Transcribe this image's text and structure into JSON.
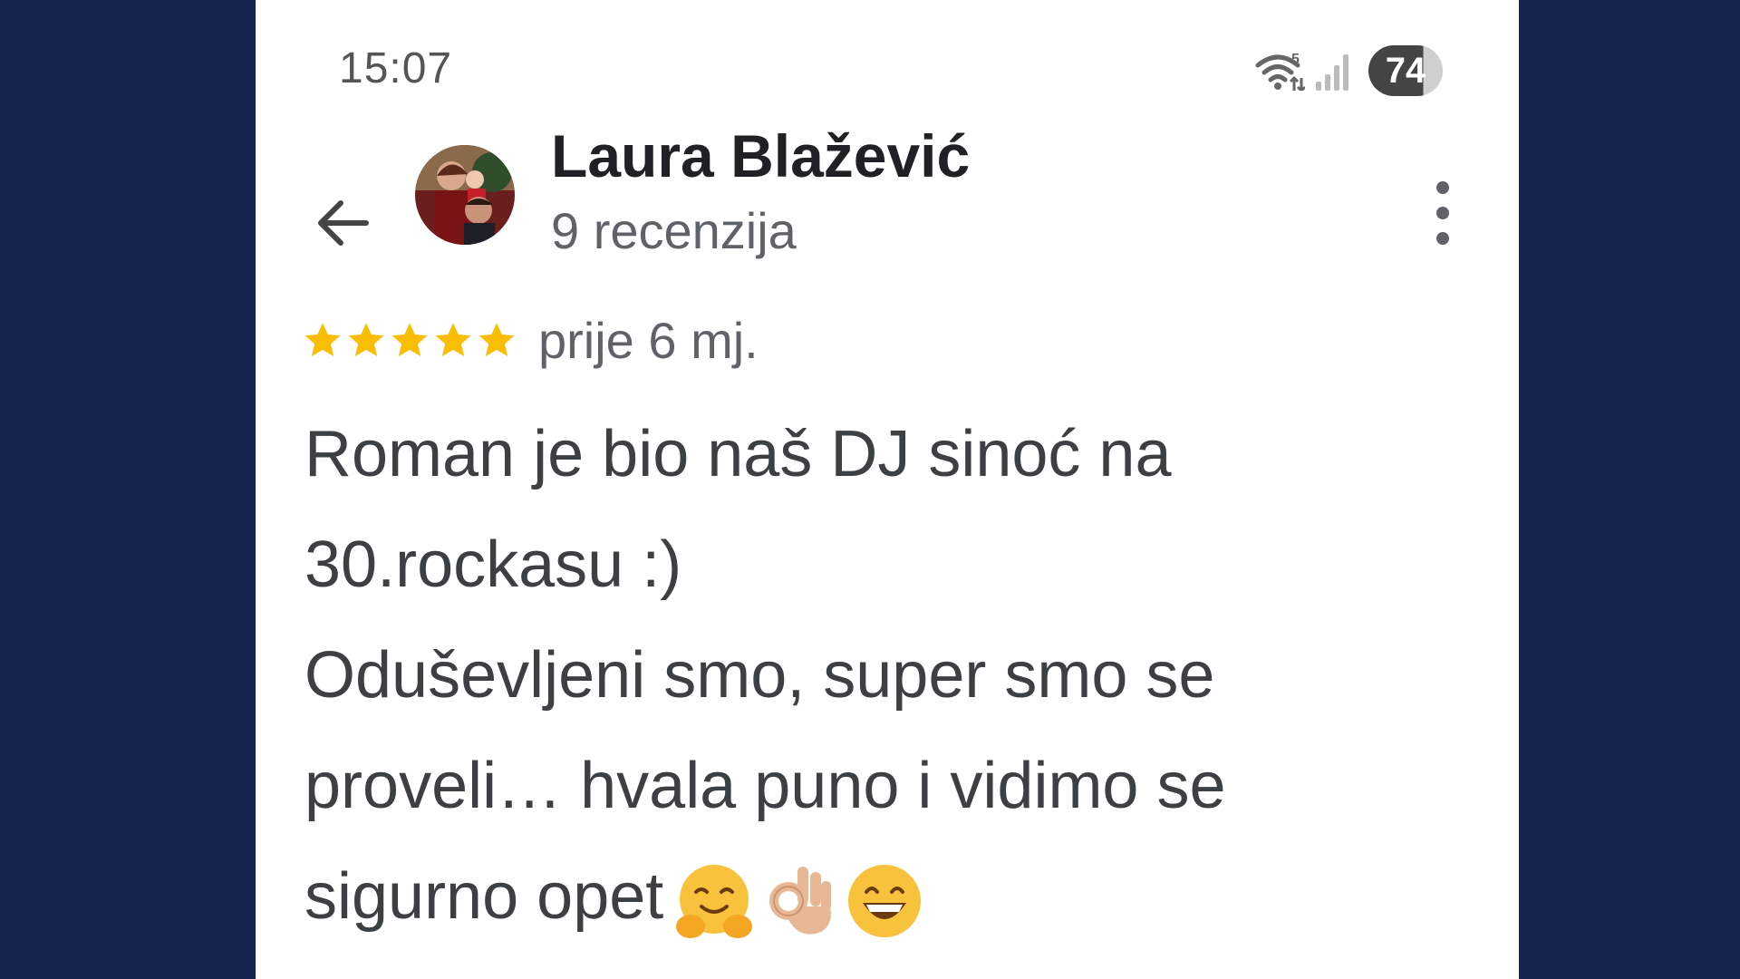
{
  "status_bar": {
    "time": "15:07",
    "wifi_badge": "5",
    "battery_level": "74",
    "icons": [
      "wifi-icon",
      "signal-icon",
      "battery-icon"
    ]
  },
  "header": {
    "back_icon": "arrow-left-icon",
    "reviewer_name": "Laura Blažević",
    "review_count": "9 recenzija",
    "more_icon": "more-vertical-icon"
  },
  "review": {
    "rating": 5,
    "rating_max": 5,
    "date": "prije 6 mj.",
    "lines": [
      "Roman je bio naš DJ sinoć na",
      "30.rockasu :)",
      "Oduševljeni smo, super smo se",
      "proveli… hvala puno i vidimo se",
      "sigurno opet"
    ],
    "emojis": [
      "hugging-face-emoji",
      "ok-hand-emoji",
      "grinning-face-emoji"
    ]
  },
  "colors": {
    "background": "#15234f",
    "card": "#ffffff",
    "star": "#fbbc04",
    "name_text": "#202124",
    "secondary_text": "#5f6368",
    "body_text": "#3c4043"
  }
}
